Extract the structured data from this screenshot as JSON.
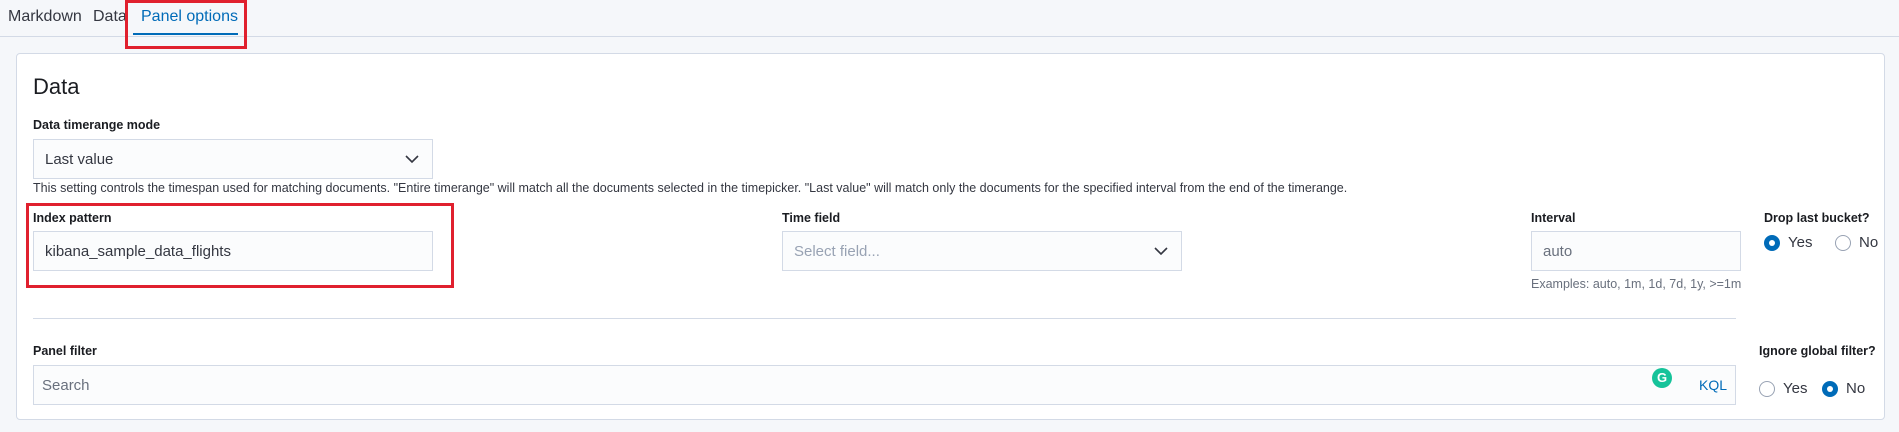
{
  "tabs": [
    {
      "label": "Markdown"
    },
    {
      "label": "Data"
    },
    {
      "label": "Panel options",
      "active": true
    }
  ],
  "section": {
    "title": "Data"
  },
  "timerange": {
    "label": "Data timerange mode",
    "value": "Last value",
    "help": "This setting controls the timespan used for matching documents. \"Entire timerange\" will match all the documents selected in the timepicker. \"Last value\" will match only the documents for the specified interval from the end of the timerange."
  },
  "index_pattern": {
    "label": "Index pattern",
    "value": "kibana_sample_data_flights"
  },
  "time_field": {
    "label": "Time field",
    "placeholder": "Select field..."
  },
  "interval": {
    "label": "Interval",
    "placeholder": "auto",
    "help": "Examples: auto, 1m, 1d, 7d, 1y, >=1m"
  },
  "drop_last_bucket": {
    "label": "Drop last bucket?",
    "yes": "Yes",
    "no": "No",
    "selected": "Yes"
  },
  "panel_filter": {
    "label": "Panel filter",
    "placeholder": "Search",
    "kql": "KQL"
  },
  "ignore_global_filter": {
    "label": "Ignore global filter?",
    "yes": "Yes",
    "no": "No",
    "selected": "No"
  },
  "colors": {
    "accent": "#006bb8",
    "highlight": "#e0202e"
  }
}
